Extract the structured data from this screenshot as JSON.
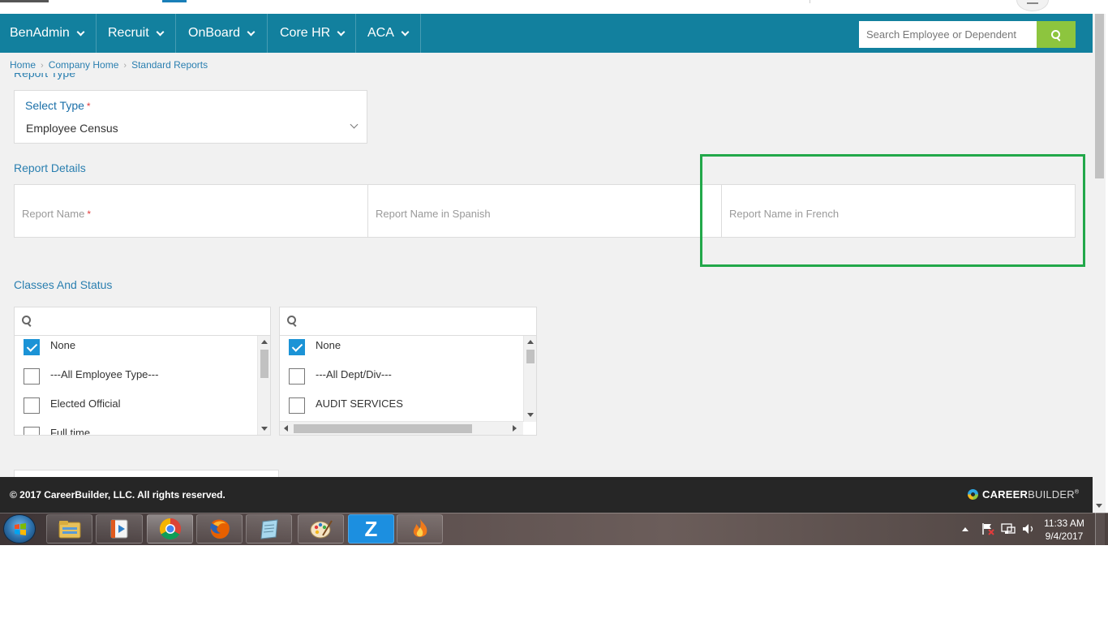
{
  "nav": {
    "items": [
      {
        "label": "BenAdmin"
      },
      {
        "label": "Recruit"
      },
      {
        "label": "OnBoard"
      },
      {
        "label": "Core HR"
      },
      {
        "label": "ACA"
      }
    ],
    "search_placeholder": "Search Employee or Dependent",
    "brand_color": "#12809e",
    "search_button_color": "#8dc53e"
  },
  "breadcrumb": [
    "Home",
    "Company Home",
    "Standard Reports"
  ],
  "report_type": {
    "section_label": "Report Type",
    "select_label": "Select Type",
    "required_mark": "*",
    "selected_value": "Employee Census"
  },
  "report_details": {
    "section_label": "Report Details",
    "name_placeholder": "Report Name",
    "required_mark": "*",
    "spanish_placeholder": "Report Name in Spanish",
    "french_placeholder": "Report Name in French",
    "highlight_color": "#22a84a"
  },
  "classes_status": {
    "section_label": "Classes And Status",
    "left_list": [
      {
        "label": "None",
        "checked": true
      },
      {
        "label": "---All Employee Type---",
        "checked": false
      },
      {
        "label": "Elected Official",
        "checked": false
      },
      {
        "label": "Full time",
        "checked": false
      }
    ],
    "right_list": [
      {
        "label": "None",
        "checked": true
      },
      {
        "label": "---All Dept/Div---",
        "checked": false
      },
      {
        "label": "AUDIT SERVICES",
        "checked": false
      }
    ],
    "checkbox_color": "#1b93d6"
  },
  "footer": {
    "copyright": "© 2017 CareerBuilder, LLC. All rights reserved.",
    "logo_bold": "CAREER",
    "logo_light": "BUILDER",
    "logo_mark": "®"
  },
  "taskbar": {
    "apps": [
      "start-orb-icon",
      "file-explorer-icon",
      "media-player-icon",
      "chrome-icon",
      "firefox-icon",
      "notepad-icon",
      "paint-icon",
      "zoom-z-icon",
      "flame-app-icon"
    ],
    "zoom_letter": "Z",
    "clock_time": "11:33 AM",
    "clock_date": "9/4/2017"
  }
}
